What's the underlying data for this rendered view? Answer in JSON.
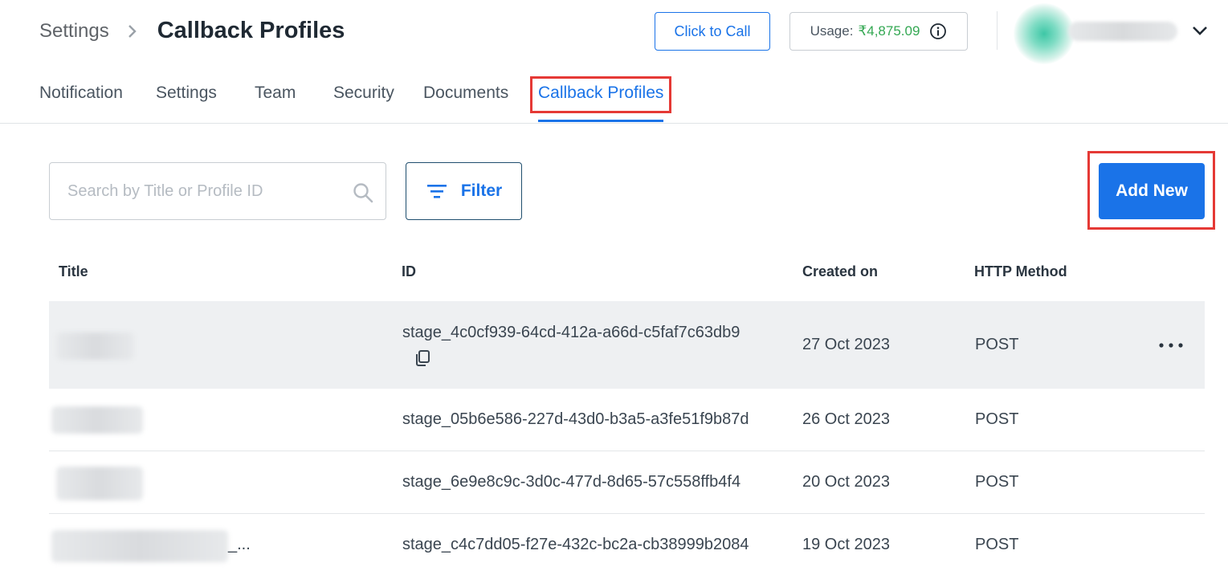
{
  "header": {
    "breadcrumb_root": "Settings",
    "page_title": "Callback Profiles",
    "click_to_call_label": "Click to Call",
    "usage_label": "Usage:",
    "usage_value": "₹4,875.09"
  },
  "tabs": [
    {
      "label": "Notification"
    },
    {
      "label": "Settings"
    },
    {
      "label": "Team"
    },
    {
      "label": "Security"
    },
    {
      "label": "Documents"
    },
    {
      "label": "Callback Profiles"
    }
  ],
  "toolbar": {
    "search_placeholder": "Search by Title or Profile ID",
    "filter_label": "Filter",
    "add_new_label": "Add New"
  },
  "table": {
    "headers": [
      "Title",
      "ID",
      "Created on",
      "HTTP Method"
    ],
    "rows": [
      {
        "title_suffix": "",
        "id": "stage_4c0cf939-64cd-412a-a66d-c5faf7c63db9",
        "created_on": "27 Oct 2023",
        "method": "POST"
      },
      {
        "title_suffix": "",
        "id": "stage_05b6e586-227d-43d0-b3a5-a3fe51f9b87d",
        "created_on": "26 Oct 2023",
        "method": "POST"
      },
      {
        "title_suffix": "",
        "id": "stage_6e9e8c9c-3d0c-477d-8d65-57c558ffb4f4",
        "created_on": "20 Oct 2023",
        "method": "POST"
      },
      {
        "title_suffix": "_...",
        "id": "stage_c4c7dd05-f27e-432c-bc2a-cb38999b2084",
        "created_on": "19 Oct 2023",
        "method": "POST"
      }
    ]
  },
  "colors": {
    "accent": "#1a73e8",
    "usage_value": "#34a853",
    "highlight": "#e53935"
  },
  "icons": [
    "chevron-right-icon",
    "info-icon",
    "chevron-down-icon",
    "search-icon",
    "filter-icon",
    "copy-icon",
    "more-horizontal-icon"
  ]
}
